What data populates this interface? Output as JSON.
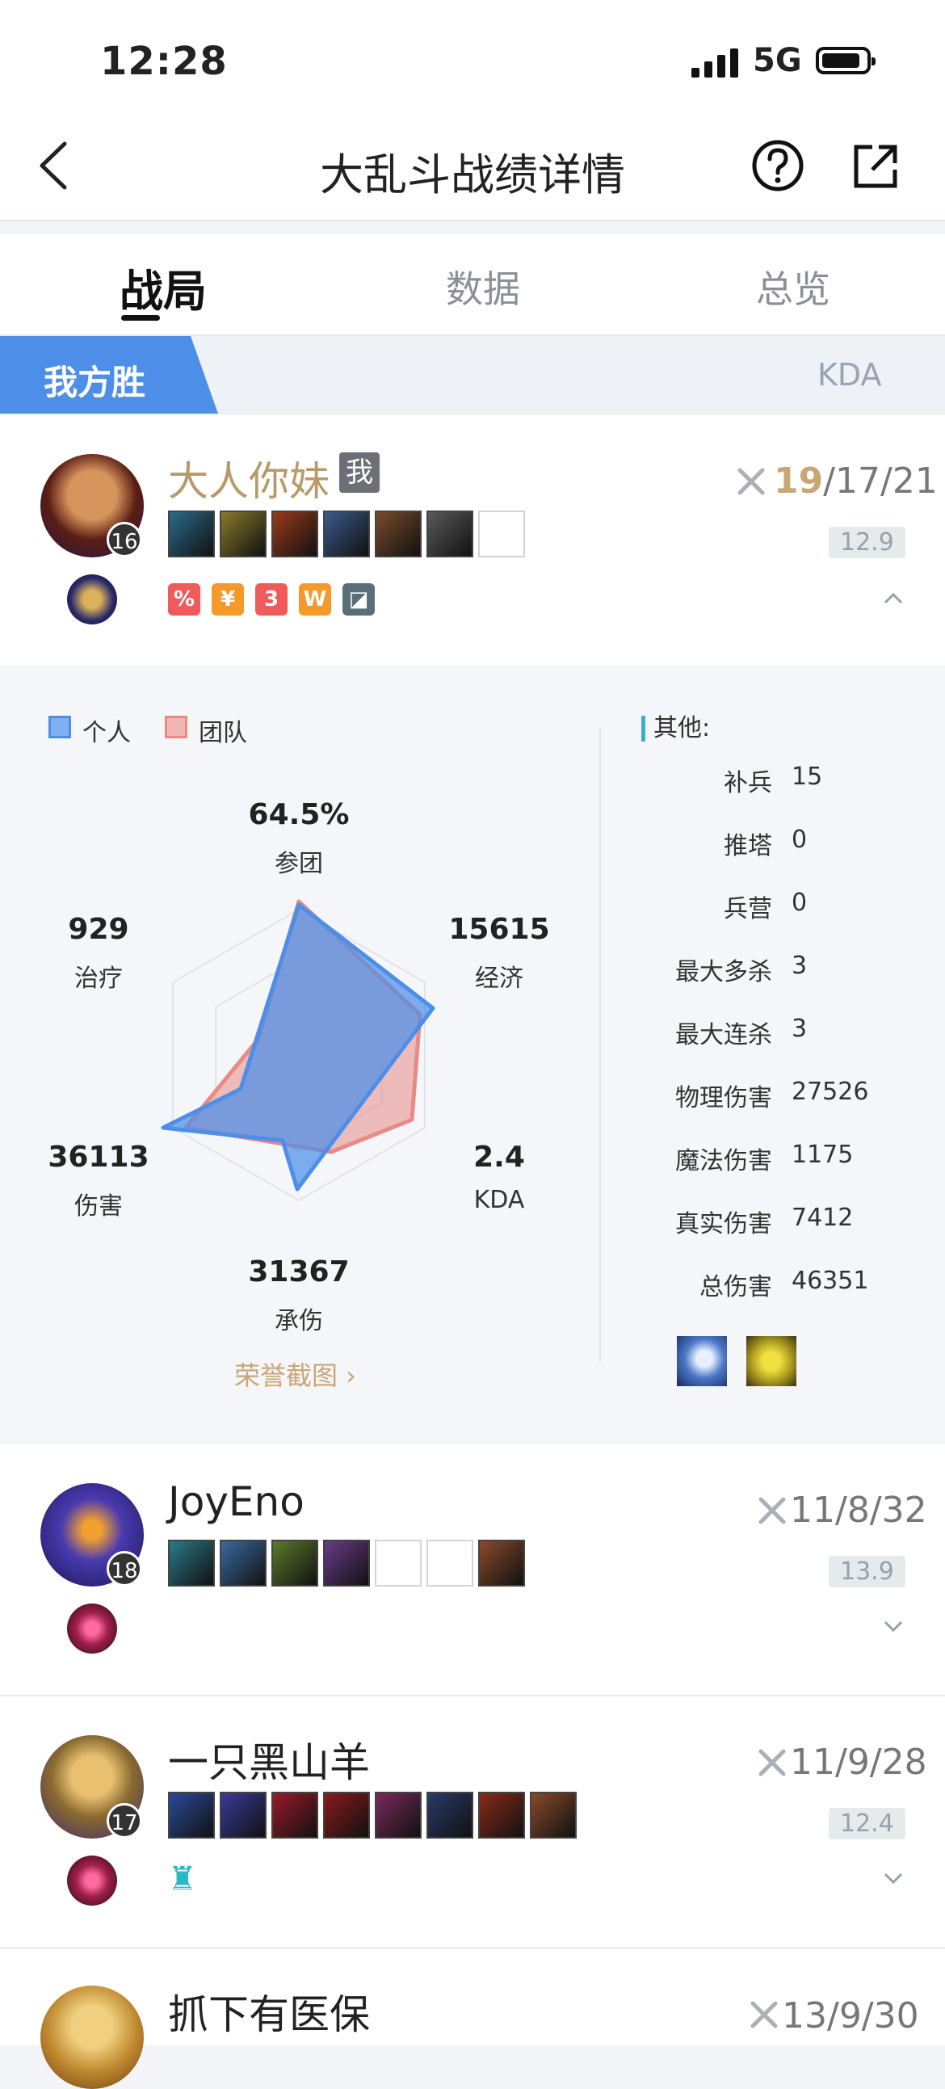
{
  "status_bar": {
    "time": "12:28",
    "network": "5G"
  },
  "nav": {
    "title": "大乱斗战绩详情"
  },
  "tabs": [
    {
      "label": "战局",
      "active": true
    },
    {
      "label": "数据",
      "active": false
    },
    {
      "label": "总览",
      "active": false
    }
  ],
  "result": {
    "label": "我方胜",
    "column": "KDA",
    "color": "#4d8fe8"
  },
  "players": [
    {
      "name": "大人你妹",
      "me_badge": "我",
      "level": "16",
      "kills": "19",
      "score_rest": "/17/21",
      "rating": "12.9",
      "expanded": true,
      "item_colors": [
        "#2a6b8a",
        "#8a7a2a",
        "#9a3a1a",
        "#3a5a8a",
        "#7a4a2a",
        "#5a5a5a",
        ""
      ],
      "tags": [
        "%",
        "¥",
        "3",
        "W",
        "◪"
      ]
    },
    {
      "name": "JoyEno",
      "level": "18",
      "score": "11/8/32",
      "rating": "13.9",
      "expanded": false,
      "item_colors": [
        "#2a7a8a",
        "#3a6aa0",
        "#5a7a2a",
        "#6a3a8a",
        "",
        "",
        "#8a4a2a"
      ]
    },
    {
      "name": "一只黑山羊",
      "level": "17",
      "score": "11/9/28",
      "rating": "12.4",
      "expanded": false,
      "item_colors": [
        "#2a4a9a",
        "#3a3a9a",
        "#9a1a2a",
        "#8a1a1a",
        "#7a2a5a",
        "#2a3a6a",
        "#8a2a1a",
        "#8a4a2a"
      ],
      "tags": [
        "♜"
      ]
    },
    {
      "name": "抓下有医保",
      "score": "13/9/30"
    }
  ],
  "radar": {
    "legend": [
      "个人",
      "团队"
    ],
    "personal_color": "#4d8fe8",
    "team_color": "#e88a85",
    "stats": [
      {
        "label": "参团",
        "value": "64.5%"
      },
      {
        "label": "经济",
        "value": "15615"
      },
      {
        "label": "KDA",
        "value": "2.4"
      },
      {
        "label": "承伤",
        "value": "31367"
      },
      {
        "label": "伤害",
        "value": "36113"
      },
      {
        "label": "治疗",
        "value": "929"
      }
    ],
    "honor_link": "荣誉截图 ›"
  },
  "other": {
    "heading": "其他:",
    "rows": [
      {
        "label": "补兵",
        "value": "15"
      },
      {
        "label": "推塔",
        "value": "0"
      },
      {
        "label": "兵营",
        "value": "0"
      },
      {
        "label": "最大多杀",
        "value": "3"
      },
      {
        "label": "最大连杀",
        "value": "3"
      },
      {
        "label": "物理伤害",
        "value": "27526"
      },
      {
        "label": "魔法伤害",
        "value": "1175"
      },
      {
        "label": "真实伤害",
        "value": "7412"
      },
      {
        "label": "总伤害",
        "value": "46351"
      }
    ]
  }
}
